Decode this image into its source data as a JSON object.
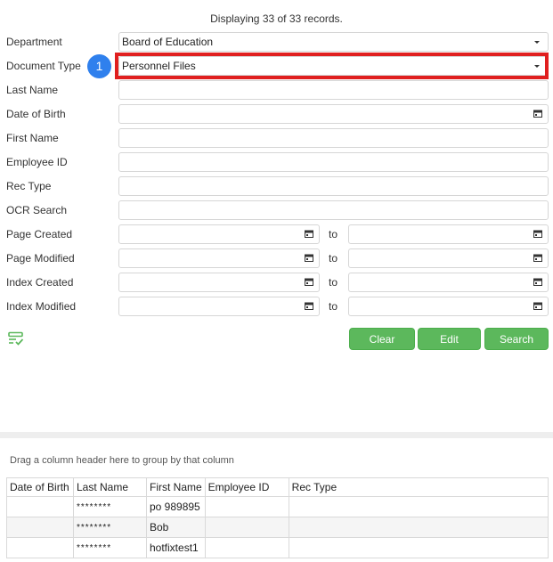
{
  "records_text": "Displaying 33 of 33 records.",
  "step_badge": "1",
  "fields": {
    "department": {
      "label": "Department",
      "value": "Board of Education"
    },
    "document_type": {
      "label": "Document Type",
      "value": "Personnel Files"
    },
    "last_name": {
      "label": "Last Name",
      "value": ""
    },
    "date_of_birth": {
      "label": "Date of Birth",
      "value": ""
    },
    "first_name": {
      "label": "First Name",
      "value": ""
    },
    "employee_id": {
      "label": "Employee ID",
      "value": ""
    },
    "rec_type": {
      "label": "Rec Type",
      "value": ""
    },
    "ocr_search": {
      "label": "OCR Search",
      "value": ""
    },
    "page_created": {
      "label": "Page Created"
    },
    "page_modified": {
      "label": "Page Modified"
    },
    "index_created": {
      "label": "Index Created"
    },
    "index_modified": {
      "label": "Index Modified"
    }
  },
  "range_separator": "to",
  "buttons": {
    "clear": "Clear",
    "edit": "Edit",
    "search": "Search"
  },
  "grid": {
    "group_hint": "Drag a column header here to group by that column",
    "columns": [
      "Date of Birth",
      "Last Name",
      "First Name",
      "Employee ID",
      "Rec Type"
    ],
    "rows": [
      [
        "",
        "********",
        "po 989895",
        "",
        ""
      ],
      [
        "",
        "********",
        "Bob",
        "",
        ""
      ],
      [
        "",
        "********",
        "hotfixtest1",
        "",
        ""
      ]
    ]
  },
  "icons": {
    "saved_search": "list-check-icon",
    "calendar": "calendar-icon",
    "dropdown": "caret-down-icon"
  },
  "colors": {
    "button_green": "#5cb85c",
    "highlight_red": "#e01f1f",
    "badge_blue": "#2f80ed"
  }
}
